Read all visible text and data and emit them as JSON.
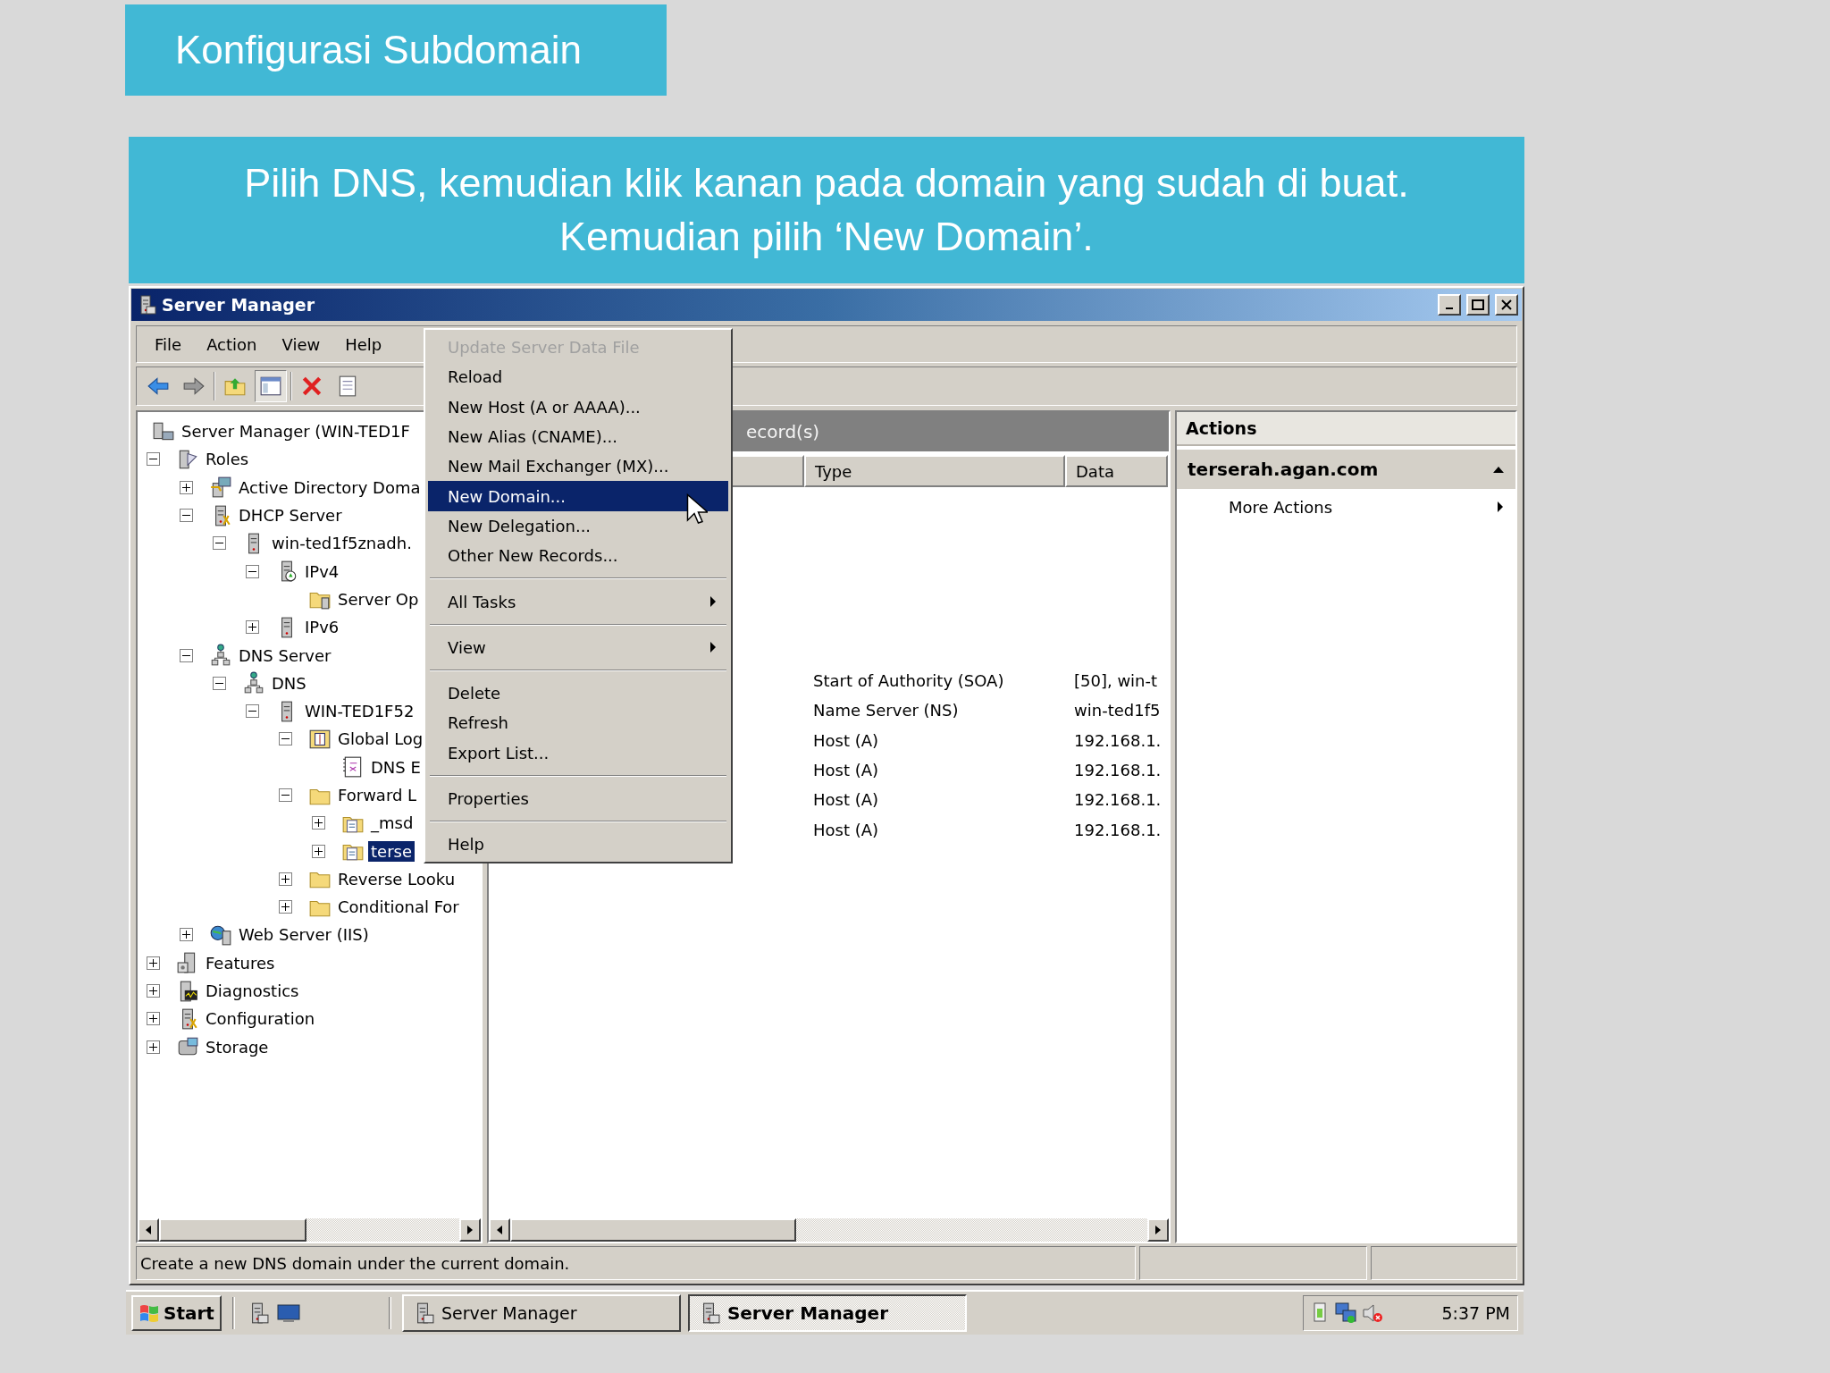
{
  "slide_title": "Konfigurasi Subdomain",
  "instruction": {
    "lines": [
      "Pilih DNS, kemudian klik kanan pada domain yang sudah di buat.",
      "Kemudian pilih ‘New Domain’."
    ]
  },
  "window": {
    "title": "Server Manager"
  },
  "menu_bar": [
    "File",
    "Action",
    "View",
    "Help"
  ],
  "toolbar": [
    {
      "kind": "back",
      "pressed": false
    },
    {
      "kind": "forward",
      "pressed": false
    },
    {
      "kind": "up",
      "pressed": false
    },
    {
      "kind": "tree",
      "pressed": true
    },
    {
      "kind": "delete",
      "pressed": false
    },
    {
      "kind": "properties",
      "pressed": false
    }
  ],
  "tree": {
    "label": "Server Manager (WIN-TED1F",
    "kind": "computer",
    "selected": false,
    "children": [
      {
        "label": "Roles",
        "kind": "roles",
        "expanded": true,
        "selected": false,
        "children": [
          {
            "label": "Active Directory Doma",
            "kind": "directory",
            "expanded": false,
            "selected": false
          },
          {
            "label": "DHCP Server",
            "kind": "tool",
            "expanded": true,
            "selected": false,
            "children": [
              {
                "label": "win-ted1f5znadh.",
                "kind": "server",
                "expanded": true,
                "selected": false,
                "children": [
                  {
                    "label": "IPv4",
                    "kind": "ipv4",
                    "expanded": true,
                    "selected": false,
                    "children": [
                      {
                        "label": "Server Op",
                        "kind": "folder-server",
                        "selected": false
                      }
                    ]
                  },
                  {
                    "label": "IPv6",
                    "kind": "server",
                    "expanded": false,
                    "selected": false
                  }
                ]
              }
            ]
          },
          {
            "label": "DNS Server",
            "kind": "network",
            "expanded": true,
            "selected": false,
            "children": [
              {
                "label": "DNS",
                "kind": "network",
                "expanded": true,
                "selected": false,
                "children": [
                  {
                    "label": "WIN-TED1F52",
                    "kind": "server",
                    "expanded": true,
                    "selected": false,
                    "children": [
                      {
                        "label": "Global Log",
                        "kind": "log",
                        "expanded": true,
                        "selected": false,
                        "children": [
                          {
                            "label": "DNS E",
                            "kind": "book",
                            "selected": false
                          }
                        ]
                      },
                      {
                        "label": "Forward L",
                        "kind": "folder",
                        "expanded": true,
                        "selected": false,
                        "children": [
                          {
                            "label": "_msd",
                            "kind": "zone",
                            "expanded": false,
                            "selected": false
                          },
                          {
                            "label": "terse",
                            "kind": "zone",
                            "expanded": false,
                            "selected": true
                          }
                        ]
                      },
                      {
                        "label": "Reverse Looku",
                        "kind": "folder",
                        "expanded": false,
                        "selected": false
                      },
                      {
                        "label": "Conditional For",
                        "kind": "folder",
                        "expanded": false,
                        "selected": false
                      }
                    ]
                  }
                ]
              }
            ]
          },
          {
            "label": "Web Server (IIS)",
            "kind": "web",
            "expanded": false,
            "selected": false
          }
        ]
      },
      {
        "label": "Features",
        "kind": "features",
        "expanded": false,
        "selected": false
      },
      {
        "label": "Diagnostics",
        "kind": "diagnostics",
        "expanded": false,
        "selected": false
      },
      {
        "label": "Configuration",
        "kind": "tool",
        "expanded": false,
        "selected": false
      },
      {
        "label": "Storage",
        "kind": "storage",
        "expanded": false,
        "selected": false
      }
    ]
  },
  "records": {
    "title": "ecord(s)",
    "columns": [
      "Type",
      "Data"
    ],
    "rows": [
      {
        "type": "Start of Authority (SOA)",
        "data": "[50], win-t"
      },
      {
        "type": "Name Server (NS)",
        "data": "win-ted1f5"
      },
      {
        "type": "Host (A)",
        "data": "192.168.1."
      },
      {
        "type": "Host (A)",
        "data": "192.168.1."
      },
      {
        "type": "Host (A)",
        "data": "192.168.1."
      },
      {
        "type": "Host (A)",
        "data": "192.168.1."
      }
    ]
  },
  "actions": {
    "title": "Actions",
    "section": "terserah.agan.com",
    "items": [
      "More Actions"
    ]
  },
  "context_menu": {
    "groups": [
      [
        {
          "label": "Update Server Data File",
          "disabled": true,
          "selected": false,
          "submenu": false
        },
        {
          "label": "Reload",
          "disabled": false,
          "selected": false,
          "submenu": false
        },
        {
          "label": "New Host (A or AAAA)...",
          "disabled": false,
          "selected": false,
          "submenu": false
        },
        {
          "label": "New Alias (CNAME)...",
          "disabled": false,
          "selected": false,
          "submenu": false
        },
        {
          "label": "New Mail Exchanger (MX)...",
          "disabled": false,
          "selected": false,
          "submenu": false
        },
        {
          "label": "New Domain...",
          "disabled": false,
          "selected": true,
          "submenu": false
        },
        {
          "label": "New Delegation...",
          "disabled": false,
          "selected": false,
          "submenu": false
        },
        {
          "label": "Other New Records...",
          "disabled": false,
          "selected": false,
          "submenu": false
        }
      ],
      [
        {
          "label": "All Tasks",
          "disabled": false,
          "selected": false,
          "submenu": true
        }
      ],
      [
        {
          "label": "View",
          "disabled": false,
          "selected": false,
          "submenu": true
        }
      ],
      [
        {
          "label": "Delete",
          "disabled": false,
          "selected": false,
          "submenu": false
        },
        {
          "label": "Refresh",
          "disabled": false,
          "selected": false,
          "submenu": false
        },
        {
          "label": "Export List...",
          "disabled": false,
          "selected": false,
          "submenu": false
        }
      ],
      [
        {
          "label": "Properties",
          "disabled": false,
          "selected": false,
          "submenu": false
        }
      ],
      [
        {
          "label": "Help",
          "disabled": false,
          "selected": false,
          "submenu": false
        }
      ]
    ]
  },
  "status_bar": "Create a new DNS domain under the current domain.",
  "taskbar": {
    "start": "Start",
    "tasks": [
      {
        "label": "Server Manager",
        "selected": false
      },
      {
        "label": "Server Manager",
        "selected": true
      }
    ],
    "clock": "5:37 PM"
  }
}
